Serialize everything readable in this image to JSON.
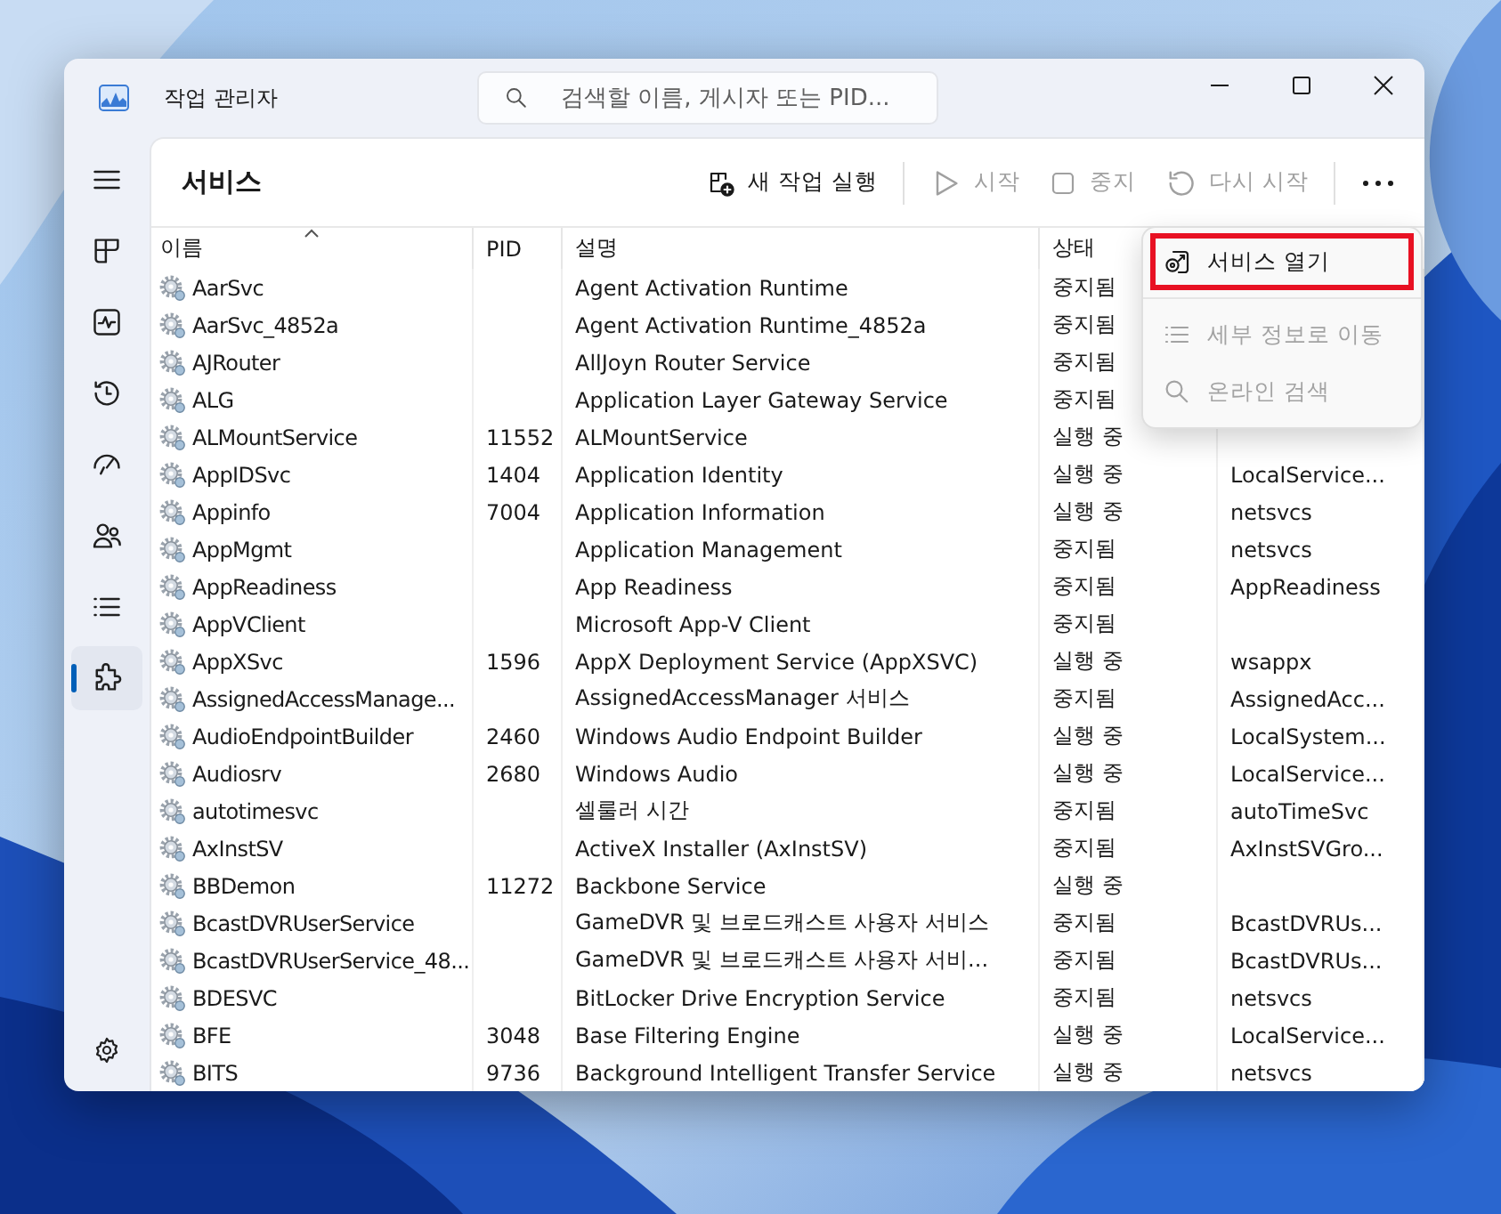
{
  "window": {
    "title": "작업 관리자"
  },
  "search": {
    "placeholder": "검색할 이름, 게시자 또는 PID..."
  },
  "sidebar": {
    "items": [
      {
        "selected": false
      },
      {
        "selected": false
      },
      {
        "selected": false
      },
      {
        "selected": false
      },
      {
        "selected": false
      },
      {
        "selected": false
      },
      {
        "selected": true
      }
    ]
  },
  "page": {
    "title": "서비스"
  },
  "toolbar": {
    "buttons": [
      {
        "kind": "new",
        "label": "새 작업 실행",
        "disabled": false
      },
      {
        "kind": "start",
        "label": "시작",
        "disabled": true
      },
      {
        "kind": "stop",
        "label": "중지",
        "disabled": true
      },
      {
        "kind": "restart",
        "label": "다시 시작",
        "disabled": true
      }
    ]
  },
  "table": {
    "columns": [
      {
        "label": "이름",
        "sorted": true
      },
      {
        "label": "PID",
        "sorted": false
      },
      {
        "label": "설명",
        "sorted": false
      },
      {
        "label": "상태",
        "sorted": false
      }
    ],
    "rows": [
      {
        "name": "AarSvc",
        "description": "Agent Activation Runtime",
        "status": "중지됨"
      },
      {
        "name": "AarSvc_4852a",
        "description": "Agent Activation Runtime_4852a",
        "status": "중지됨"
      },
      {
        "name": "AJRouter",
        "description": "AllJoyn Router Service",
        "status": "중지됨"
      },
      {
        "name": "ALG",
        "description": "Application Layer Gateway Service",
        "status": "중지됨"
      },
      {
        "name": "ALMountService",
        "pid": "11552",
        "description": "ALMountService",
        "status": "실행 중"
      },
      {
        "name": "AppIDSvc",
        "pid": "1404",
        "description": "Application Identity",
        "status": "실행 중",
        "group": "LocalService..."
      },
      {
        "name": "Appinfo",
        "pid": "7004",
        "description": "Application Information",
        "status": "실행 중",
        "group": "netsvcs"
      },
      {
        "name": "AppMgmt",
        "description": "Application Management",
        "status": "중지됨",
        "group": "netsvcs"
      },
      {
        "name": "AppReadiness",
        "description": "App Readiness",
        "status": "중지됨",
        "group": "AppReadiness"
      },
      {
        "name": "AppVClient",
        "description": "Microsoft App-V Client",
        "status": "중지됨"
      },
      {
        "name": "AppXSvc",
        "pid": "1596",
        "description": "AppX Deployment Service (AppXSVC)",
        "status": "실행 중",
        "group": "wsappx"
      },
      {
        "name": "AssignedAccessManage...",
        "description": "AssignedAccessManager 서비스",
        "status": "중지됨",
        "group": "AssignedAcc..."
      },
      {
        "name": "AudioEndpointBuilder",
        "pid": "2460",
        "description": "Windows Audio Endpoint Builder",
        "status": "실행 중",
        "group": "LocalSystem..."
      },
      {
        "name": "Audiosrv",
        "pid": "2680",
        "description": "Windows Audio",
        "status": "실행 중",
        "group": "LocalService..."
      },
      {
        "name": "autotimesvc",
        "description": "셀룰러 시간",
        "status": "중지됨",
        "group": "autoTimeSvc"
      },
      {
        "name": "AxInstSV",
        "description": "ActiveX Installer (AxInstSV)",
        "status": "중지됨",
        "group": "AxInstSVGro..."
      },
      {
        "name": "BBDemon",
        "pid": "11272",
        "description": "Backbone Service",
        "status": "실행 중"
      },
      {
        "name": "BcastDVRUserService",
        "description": "GameDVR 및 브로드캐스트 사용자 서비스",
        "status": "중지됨",
        "group": "BcastDVRUs..."
      },
      {
        "name": "BcastDVRUserService_48...",
        "description": "GameDVR 및 브로드캐스트 사용자 서비...",
        "status": "중지됨",
        "group": "BcastDVRUs..."
      },
      {
        "name": "BDESVC",
        "description": "BitLocker Drive Encryption Service",
        "status": "중지됨",
        "group": "netsvcs"
      },
      {
        "name": "BFE",
        "pid": "3048",
        "description": "Base Filtering Engine",
        "status": "실행 중",
        "group": "LocalService..."
      },
      {
        "name": "BITS",
        "pid": "9736",
        "description": "Background Intelligent Transfer Service",
        "status": "실행 중",
        "group": "netsvcs"
      }
    ]
  },
  "context_menu": {
    "items": [
      {
        "kind": "open",
        "label": "서비스 열기",
        "disabled": false,
        "highlighted": true
      },
      {
        "kind": "details",
        "label": "세부 정보로 이동",
        "disabled": true,
        "highlighted": false
      },
      {
        "kind": "search",
        "label": "온라인 검색",
        "disabled": true,
        "highlighted": false
      }
    ]
  }
}
